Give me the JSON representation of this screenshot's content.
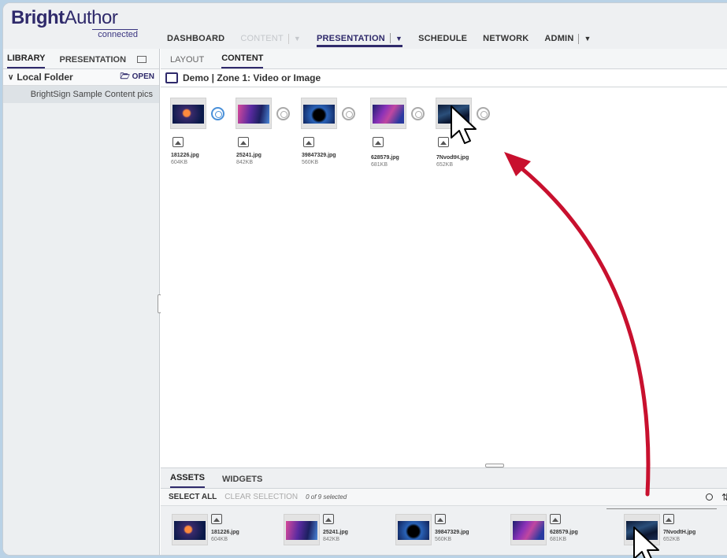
{
  "brand": {
    "name_bold": "Bright",
    "name_regular": "Author",
    "tagline": "connected"
  },
  "nav": [
    {
      "label": "DASHBOARD"
    },
    {
      "label": "CONTENT"
    },
    {
      "label": "PRESENTATION"
    },
    {
      "label": "SCHEDULE"
    },
    {
      "label": "NETWORK"
    },
    {
      "label": "ADMIN"
    }
  ],
  "left": {
    "tabs": [
      "LIBRARY",
      "PRESENTATION"
    ],
    "folder": {
      "label": "Local Folder",
      "open_label": "OPEN"
    },
    "folder_item": "BrightSign Sample Content pics"
  },
  "main": {
    "tabs": [
      "LAYOUT",
      "CONTENT"
    ],
    "zone_title": "Demo | Zone 1: Video or Image",
    "content_items": [
      {
        "name": "181226.jpg",
        "size": "604KB"
      },
      {
        "name": "25241.jpg",
        "size": "842KB"
      },
      {
        "name": "39847329.jpg",
        "size": "560KB"
      },
      {
        "name": "628579.jpg",
        "size": "681KB"
      },
      {
        "name": "7NvodtH.jpg",
        "size": "652KB"
      }
    ]
  },
  "assets": {
    "tabs": [
      "ASSETS",
      "WIDGETS"
    ],
    "select_all": "SELECT ALL",
    "clear_selection": "CLEAR SELECTION",
    "selection_count": "0 of 9 selected",
    "items": [
      {
        "name": "181226.jpg",
        "size": "604KB"
      },
      {
        "name": "25241.jpg",
        "size": "842KB"
      },
      {
        "name": "39847329.jpg",
        "size": "560KB"
      },
      {
        "name": "628579.jpg",
        "size": "681KB"
      },
      {
        "name": "7NvodtH.jpg",
        "size": "652KB"
      }
    ]
  },
  "colors": {
    "brand": "#2f2a6b",
    "arrow": "#c8102e",
    "background": "#b9d2e6"
  }
}
